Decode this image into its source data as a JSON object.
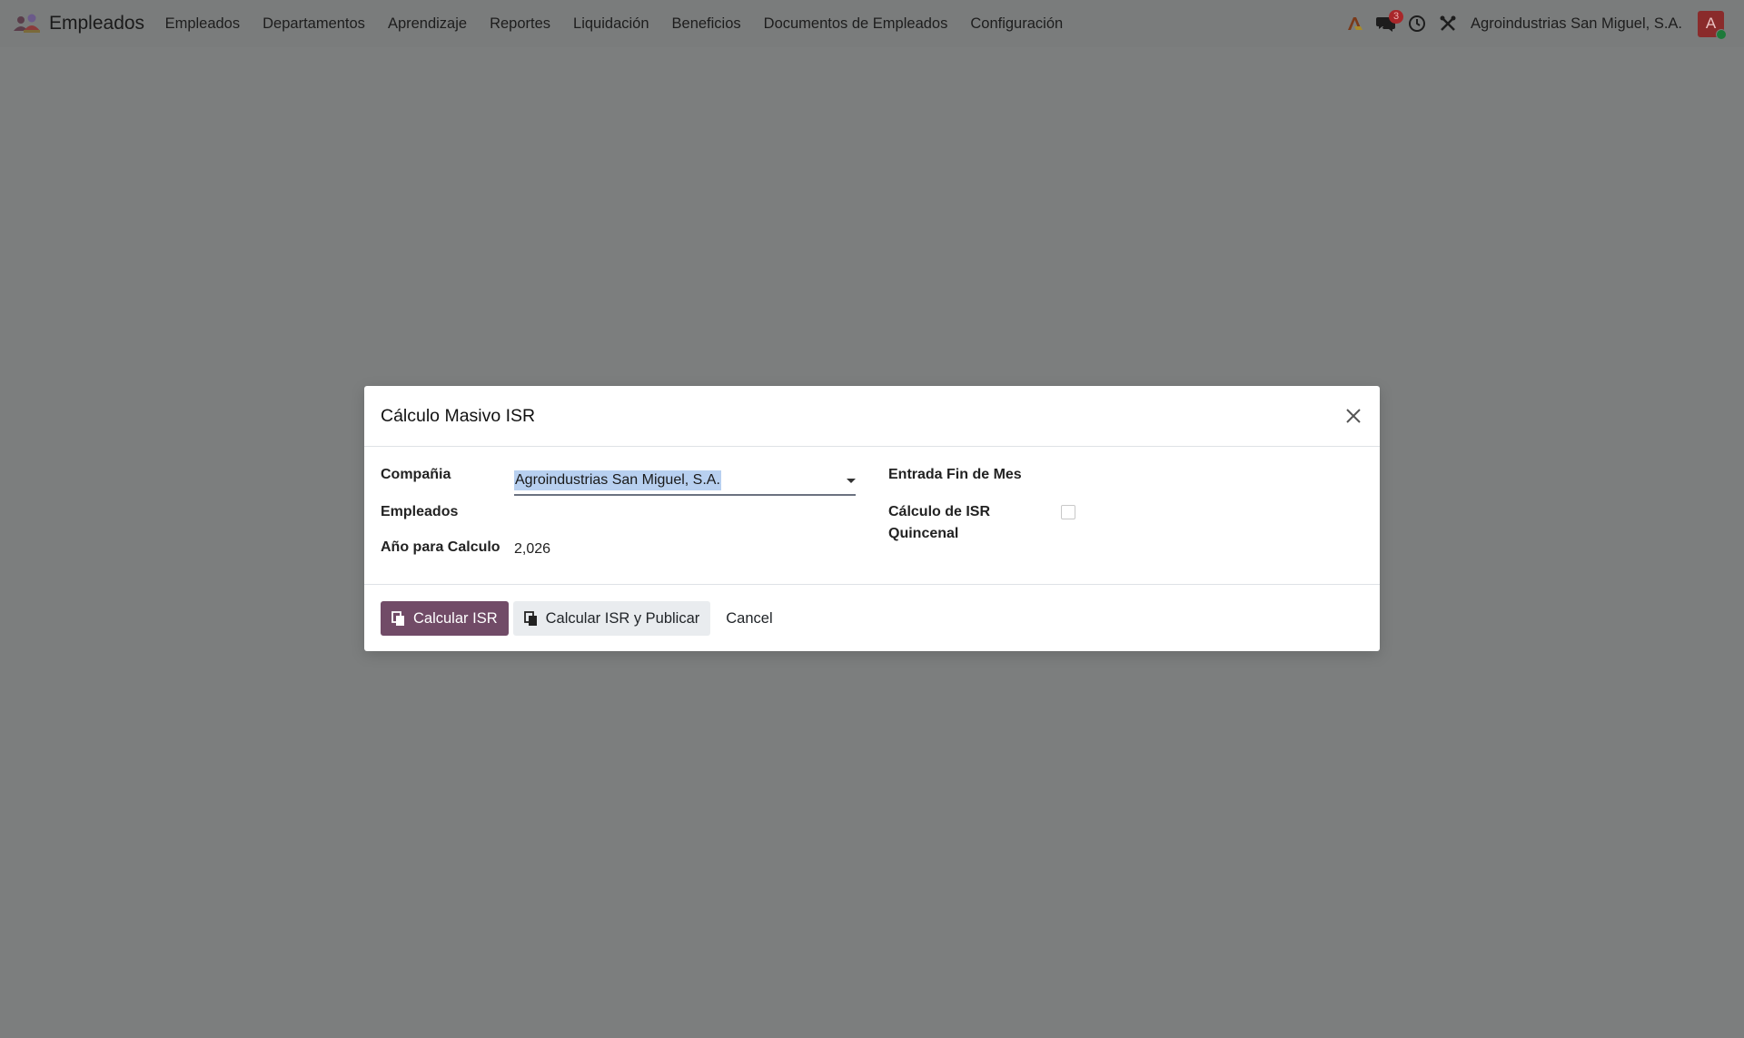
{
  "app": {
    "title": "Empleados"
  },
  "menu": {
    "items": [
      {
        "label": "Empleados"
      },
      {
        "label": "Departamentos"
      },
      {
        "label": "Aprendizaje"
      },
      {
        "label": "Reportes"
      },
      {
        "label": "Liquidación"
      },
      {
        "label": "Beneficios"
      },
      {
        "label": "Documentos de Empleados"
      },
      {
        "label": "Configuración"
      }
    ]
  },
  "systray": {
    "messages_count": "3",
    "company": "Agroindustrias San Miguel, S.A.",
    "avatar_initial": "A"
  },
  "dialog": {
    "title": "Cálculo Masivo ISR",
    "fields": {
      "company_label": "Compañia",
      "company_value": "Agroindustrias San Miguel, S.A.",
      "employees_label": "Empleados",
      "year_label": "Año para Calculo",
      "year_value": "2,026",
      "month_end_label": "Entrada Fin de Mes",
      "biweekly_label_line1": "Cálculo de ISR",
      "biweekly_label_line2": "Quincenal",
      "biweekly_checked": false
    },
    "buttons": {
      "calculate": "Calcular ISR",
      "calculate_publish": "Calcular ISR y Publicar",
      "cancel": "Cancel"
    }
  },
  "colors": {
    "primary": "#714b67",
    "backdrop": "#7c7e7e",
    "badge": "#a8272a"
  }
}
